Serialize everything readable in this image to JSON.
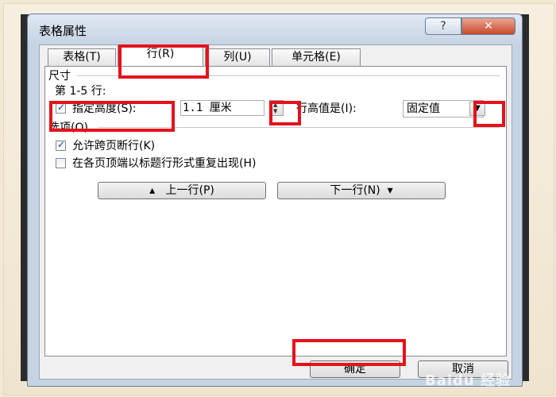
{
  "window": {
    "title": "表格属性",
    "help_glyph": "?",
    "close_glyph": "✕"
  },
  "tabs": [
    {
      "label": "表格(T)"
    },
    {
      "label": "行(R)"
    },
    {
      "label": "列(U)"
    },
    {
      "label": "单元格(E)"
    }
  ],
  "size": {
    "group_label": "尺寸",
    "rows_label": "第 1-5 行:",
    "specify_height_label": "指定高度(S):",
    "specify_height_checked": true,
    "height_value": "1.1 厘米",
    "row_height_is_label": "行高值是(I):",
    "row_height_mode": "固定值"
  },
  "options": {
    "group_label": "选项(O)",
    "allow_break_label": "允许跨页断行(K)",
    "allow_break_checked": true,
    "repeat_header_label": "在各页顶端以标题行形式重复出现(H)",
    "repeat_header_checked": false
  },
  "nav": {
    "prev_row": "上一行(P)",
    "next_row": "下一行(N)",
    "up_glyph": "▴",
    "down_glyph": "▾"
  },
  "footer": {
    "ok": "确定",
    "cancel": "取消"
  },
  "checkmark": "✓",
  "dropdown_glyph": "▼",
  "spin_up_glyph": "▲",
  "spin_down_glyph": "▼",
  "watermark": "Baidu 经验",
  "highlight_color": "#e4121b"
}
